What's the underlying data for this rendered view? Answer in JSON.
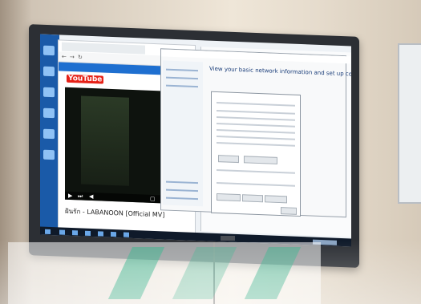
{
  "photo": {
    "subject": "wall-mounted touchscreen display",
    "accent_colors": {
      "wall": "#e2d8c9",
      "bezel": "#2c2f34",
      "desktop_blue": "#1a5aa8",
      "youtube_red": "#e62117",
      "watermark_green": "#38b28c"
    }
  },
  "browser": {
    "youtube_logo": "YouTube",
    "video_title": "ฝันรัก - LABANOON [Official MV]"
  },
  "control_panel": {
    "heading": "View your basic network information and set up connections"
  },
  "icons": [
    "play-icon",
    "skip-icon",
    "volume-icon",
    "fullscreen-icon",
    "search-icon"
  ]
}
